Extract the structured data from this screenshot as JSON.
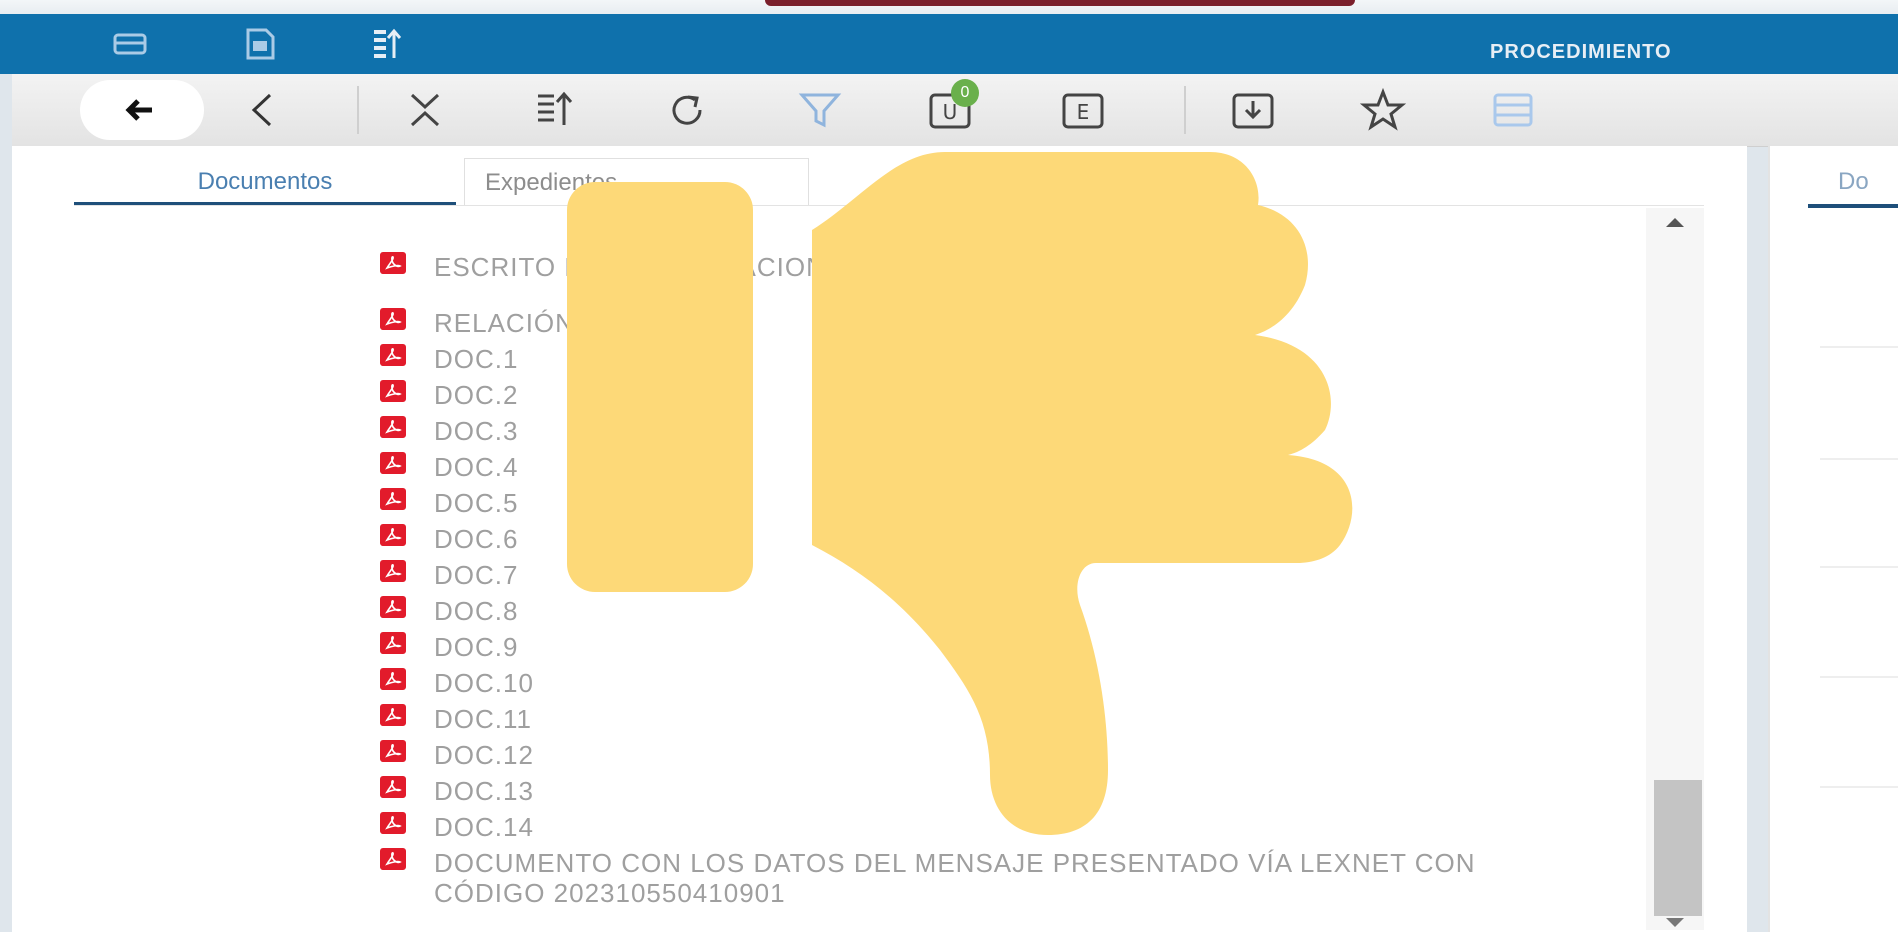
{
  "window": {
    "title": "PROCEDIMIENTO",
    "top_icons": [
      "panel-icon",
      "document-icon",
      "sort-icon"
    ]
  },
  "toolbar": {
    "buttons": [
      {
        "name": "back-arrow-button",
        "icon": "arrow-left-icon"
      },
      {
        "name": "previous-button",
        "icon": "chevron-left-icon"
      },
      {
        "name": "collapse-button",
        "icon": "collapse-icon"
      },
      {
        "name": "sort-button",
        "icon": "sort-icon"
      },
      {
        "name": "refresh-button",
        "icon": "refresh-icon"
      },
      {
        "name": "filter-button",
        "icon": "filter-icon"
      },
      {
        "name": "u-button",
        "icon": "u-box-icon",
        "label": "U"
      },
      {
        "name": "e-button",
        "icon": "e-box-icon",
        "label": "E"
      },
      {
        "name": "download-button",
        "icon": "download-icon"
      },
      {
        "name": "favorite-button",
        "icon": "star-icon"
      },
      {
        "name": "list-view-button",
        "icon": "list-icon"
      }
    ],
    "badge_count": "0"
  },
  "tabs": {
    "documentos": "Documentos",
    "expedientes": "Expedientes"
  },
  "right_tab_partial": "Do",
  "documents": [
    {
      "label": "ESCRITO DE PRESENTACION DE DOCUMENTAL FORMATO OCR"
    },
    {
      "label": "RELACIÓN DE PRUEBA"
    },
    {
      "label": "DOC.1"
    },
    {
      "label": "DOC.2"
    },
    {
      "label": "DOC.3"
    },
    {
      "label": "DOC.4"
    },
    {
      "label": "DOC.5"
    },
    {
      "label": "DOC.6"
    },
    {
      "label": "DOC.7"
    },
    {
      "label": "DOC.8"
    },
    {
      "label": "DOC.9"
    },
    {
      "label": "DOC.10"
    },
    {
      "label": "DOC.11"
    },
    {
      "label": "DOC.12"
    },
    {
      "label": "DOC.13"
    },
    {
      "label": "DOC.14"
    },
    {
      "label": "DOCUMENTO CON LOS DATOS DEL MENSAJE PRESENTADO VÍA LEXNET CON CÓDIGO 202310550410901"
    }
  ],
  "overlay": {
    "icon": "thumbs-down-icon",
    "color": "#fdd978"
  },
  "colors": {
    "header": "#0f71ac",
    "pdf": "#e21b2b",
    "accent_tab": "#1e4f7a"
  }
}
